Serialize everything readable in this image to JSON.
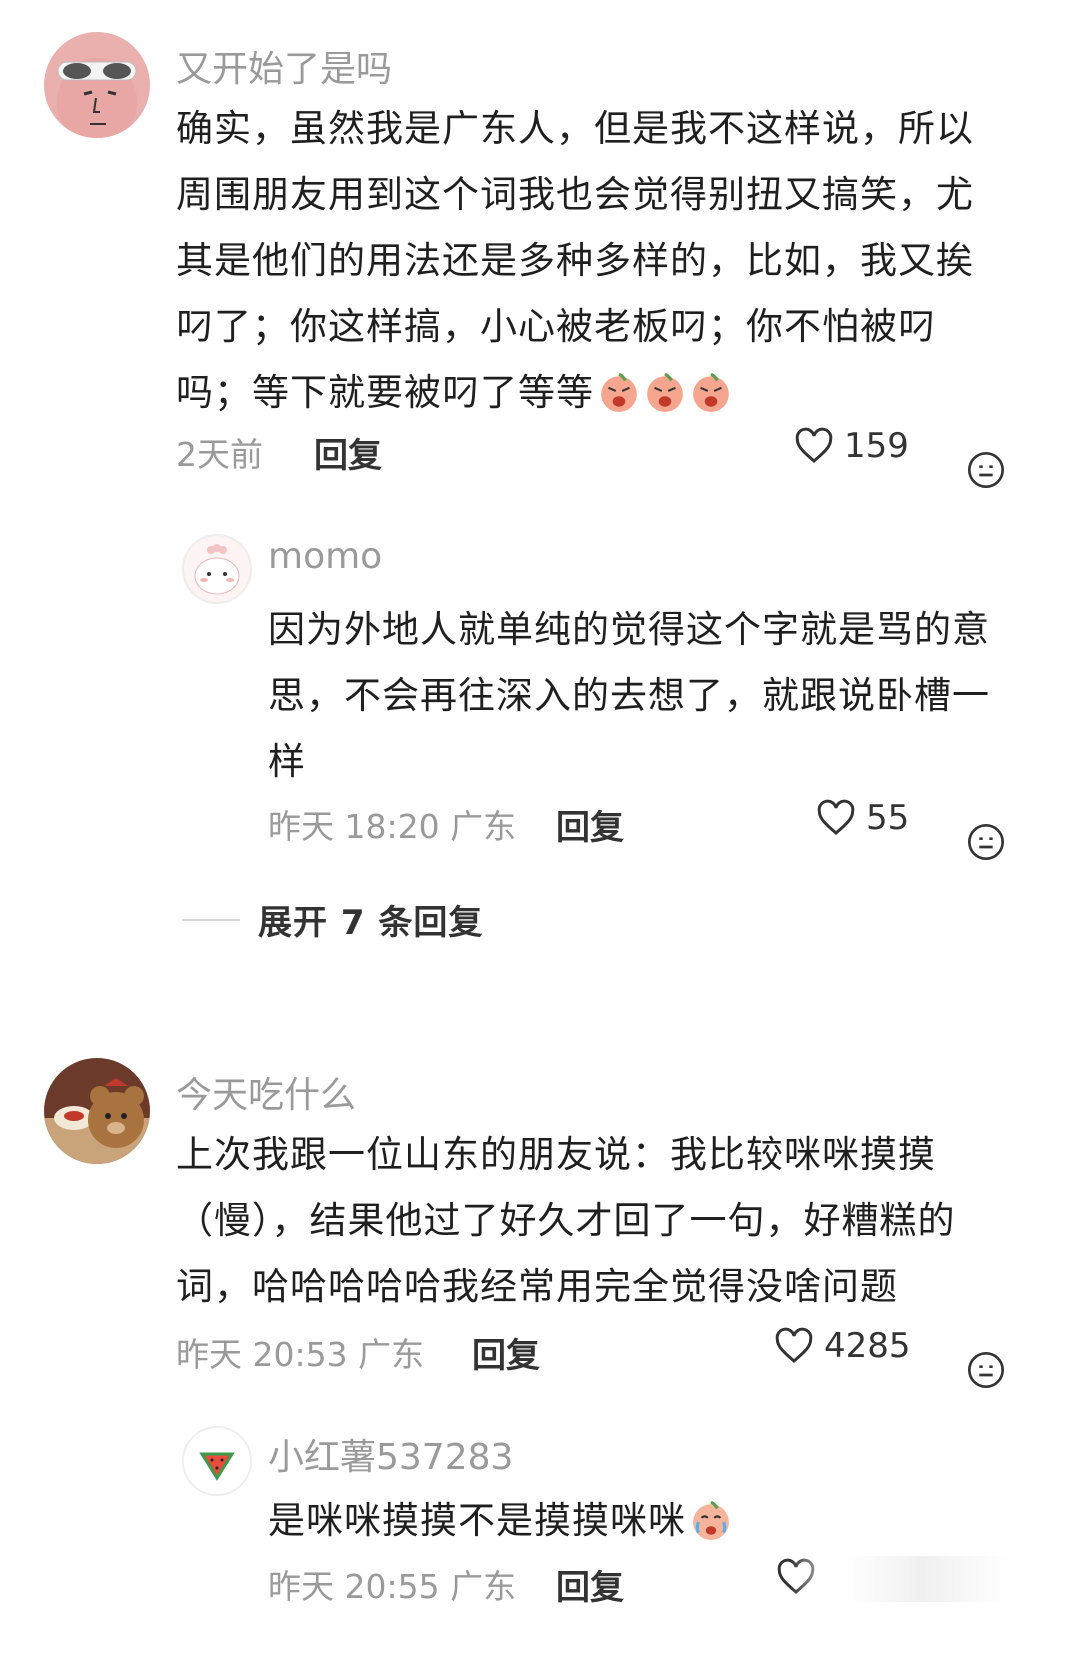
{
  "comments": [
    {
      "username": "又开始了是吗",
      "text": "确实，虽然我是广东人，但是我不这样说，所以周围朋友用到这个词我也会觉得别扭又搞笑，尤其是他们的用法还是多种多样的，比如，我又挨叼了；你这样搞，小心被老板叼；你不怕被叼吗；等下就要被叼了等等",
      "emoji_icons": [
        "crying-emoji",
        "crying-emoji",
        "crying-emoji"
      ],
      "time": "2天前",
      "reply_label": "回复",
      "likes": "159",
      "replies": [
        {
          "username": "momo",
          "text": "因为外地人就单纯的觉得这个字就是骂的意思，不会再往深入的去想了，就跟说卧槽一样",
          "time": "昨天 18:20 广东",
          "reply_label": "回复",
          "likes": "55"
        }
      ],
      "expand_label": "展开 7 条回复"
    },
    {
      "username": "今天吃什么",
      "text": "上次我跟一位山东的朋友说：我比较咪咪摸摸（慢），结果他过了好久才回了一句，好糟糕的词，哈哈哈哈哈我经常用完全觉得没啥问题",
      "time": "昨天 20:53 广东",
      "reply_label": "回复",
      "likes": "4285",
      "replies": [
        {
          "username": "小红薯537283",
          "text": "是咪咪摸摸不是摸摸咪咪",
          "emoji_icon": "crying-emoji",
          "time": "昨天 20:55 广东",
          "reply_label": "回复"
        }
      ]
    }
  ],
  "colors": {
    "meta": "#9a9a9a",
    "text": "#1f1f1f",
    "accent": "#333333"
  }
}
